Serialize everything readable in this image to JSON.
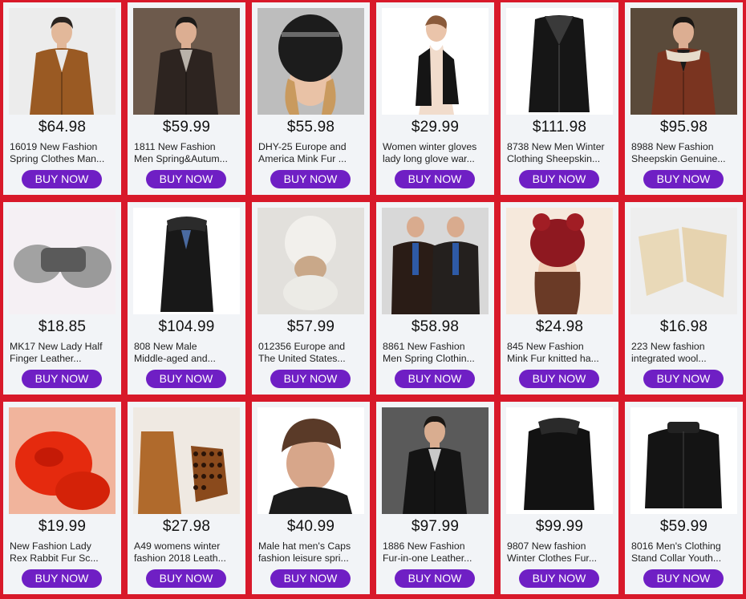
{
  "buy_label": "BUY NOW",
  "colors": {
    "background": "#d8192a",
    "card": "#f2f4f7",
    "button": "#6f1fc4"
  },
  "products": [
    {
      "price": "$64.98",
      "title_1": "16019 New Fashion",
      "title_2": "Spring Clothes Man...",
      "image": "brown-leather-jacket-man"
    },
    {
      "price": "$59.99",
      "title_1": "1811 New Fashion",
      "title_2": "Men Spring&Autum...",
      "image": "dark-leather-blazer-man"
    },
    {
      "price": "$55.98",
      "title_1": "DHY-25 Europe and",
      "title_2": "America Mink Fur ...",
      "image": "black-mink-fur-hat"
    },
    {
      "price": "$29.99",
      "title_1": "Women winter gloves",
      "title_2": "lady long glove war...",
      "image": "long-black-gloves"
    },
    {
      "price": "$111.98",
      "title_1": "8738 New Men Winter",
      "title_2": "Clothing Sheepskin...",
      "image": "black-sheepskin-coat"
    },
    {
      "price": "$95.98",
      "title_1": "8988 New Fashion",
      "title_2": "Sheepskin Genuine...",
      "image": "brown-shearling-jacket-man"
    },
    {
      "price": "$18.85",
      "title_1": "MK17 New Lady Half",
      "title_2": "Finger Leather...",
      "image": "grey-fur-fingerless-gloves"
    },
    {
      "price": "$104.99",
      "title_1": "808 New Male",
      "title_2": "Middle-aged and...",
      "image": "long-black-coat-fur-collar"
    },
    {
      "price": "$57.99",
      "title_1": "012356 Europe and",
      "title_2": "The United States...",
      "image": "white-knit-fur-hat"
    },
    {
      "price": "$58.98",
      "title_1": "8861 New Fashion",
      "title_2": "Men Spring Clothin...",
      "image": "two-men-leather-jackets"
    },
    {
      "price": "$24.98",
      "title_1": "845 New Fashion",
      "title_2": "Mink Fur knitted ha...",
      "image": "red-knit-pompom-hat"
    },
    {
      "price": "$16.98",
      "title_1": "223 New fashion",
      "title_2": "integrated wool...",
      "image": "cream-sheepskin-gloves"
    },
    {
      "price": "$19.99",
      "title_1": "New Fashion Lady",
      "title_2": "Rex Rabbit Fur Sc...",
      "image": "red-rabbit-fur-scarf"
    },
    {
      "price": "$27.98",
      "title_1": "A49 womens winter",
      "title_2": "fashion 2018 Leath...",
      "image": "leopard-print-gloves"
    },
    {
      "price": "$40.99",
      "title_1": "Male hat men's Caps",
      "title_2": "fashion leisure spri...",
      "image": "brown-leather-cap-man"
    },
    {
      "price": "$97.99",
      "title_1": "1886 New Fashion",
      "title_2": "Fur-in-one Leather...",
      "image": "black-leather-coat-man"
    },
    {
      "price": "$99.99",
      "title_1": "9807 New fashion",
      "title_2": "Winter Clothes Fur...",
      "image": "black-leather-jacket-fur-collar"
    },
    {
      "price": "$59.99",
      "title_1": "8016 Men's Clothing",
      "title_2": "Stand Collar Youth...",
      "image": "black-stand-collar-jacket"
    }
  ]
}
